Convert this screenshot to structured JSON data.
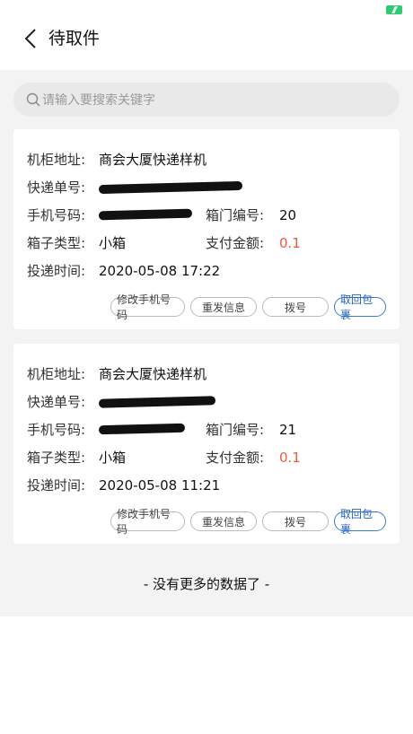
{
  "header": {
    "title": "待取件"
  },
  "search": {
    "placeholder": "请输入要搜索关键字"
  },
  "labels": {
    "address": "机柜地址:",
    "tracking": "快递单号:",
    "phone": "手机号码:",
    "door": "箱门编号:",
    "box_type": "箱子类型:",
    "amount": "支付金额:",
    "time": "投递时间:"
  },
  "orders": [
    {
      "address": "商会大厦快递样机",
      "door": "20",
      "box_type": "小箱",
      "amount": "0.1",
      "time": "2020-05-08 17:22"
    },
    {
      "address": "商会大厦快递样机",
      "door": "21",
      "box_type": "小箱",
      "amount": "0.1",
      "time": "2020-05-08 11:21"
    }
  ],
  "actions": {
    "edit_phone": "修改手机号码",
    "resend": "重发信息",
    "dial": "拨号",
    "retrieve": "取回包裹"
  },
  "footer": {
    "no_more": "- 没有更多的数据了 -"
  },
  "colors": {
    "accent": "#3a7bd5",
    "amount": "#f25a3c",
    "battery": "#2ecc71"
  }
}
